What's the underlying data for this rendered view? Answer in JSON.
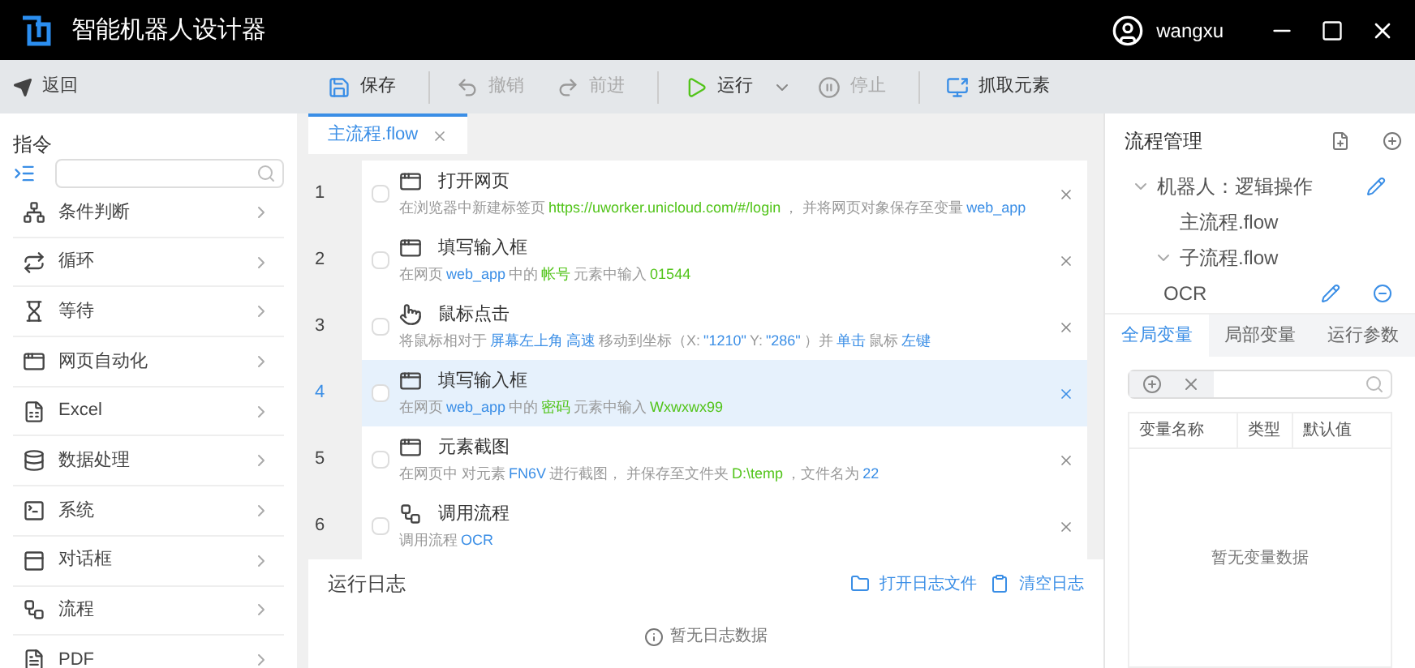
{
  "window": {
    "title": "智能机器人设计器",
    "user": "wangxu"
  },
  "toolbar": {
    "back": "返回",
    "buttons": [
      {
        "kind": "save",
        "label": "保存",
        "disabled": false
      },
      {
        "kind": "undo",
        "label": "撤销",
        "disabled": true
      },
      {
        "kind": "redo",
        "label": "前进",
        "disabled": true
      },
      {
        "kind": "run",
        "label": "运行",
        "disabled": false
      },
      {
        "kind": "stop",
        "label": "停止",
        "disabled": true
      },
      {
        "kind": "capture",
        "label": "抓取元素",
        "disabled": false
      }
    ]
  },
  "sidebar": {
    "title": "指令",
    "items": [
      "条件判断",
      "循环",
      "等待",
      "网页自动化",
      "Excel",
      "数据处理",
      "系统",
      "对话框",
      "流程",
      "PDF"
    ]
  },
  "editor_tabs": [
    {
      "label": "主流程.flow",
      "selected": true
    }
  ],
  "steps": [
    {
      "number": "1",
      "kind": "web",
      "title": "打开网页",
      "selected": false,
      "parts": [
        {
          "kind": "text",
          "text": "在浏览器中新建标签页"
        },
        {
          "kind": "value",
          "text": "https://uworker.unicloud.com/#/login"
        },
        {
          "kind": "text",
          "text": "， 并将网页对象保存至变量"
        },
        {
          "kind": "link",
          "text": "web_app"
        }
      ]
    },
    {
      "number": "2",
      "kind": "web",
      "title": "填写输入框",
      "selected": false,
      "parts": [
        {
          "kind": "text",
          "text": "在网页"
        },
        {
          "kind": "link",
          "text": "web_app"
        },
        {
          "kind": "text",
          "text": "中的"
        },
        {
          "kind": "value",
          "text": "帐号"
        },
        {
          "kind": "text",
          "text": "元素中输入"
        },
        {
          "kind": "value",
          "text": "01544"
        }
      ]
    },
    {
      "number": "3",
      "kind": "mouse",
      "title": "鼠标点击",
      "selected": false,
      "parts": [
        {
          "kind": "text",
          "text": "将鼠标相对于"
        },
        {
          "kind": "link",
          "text": "屏幕左上角"
        },
        {
          "kind": "link",
          "text": "高速"
        },
        {
          "kind": "text",
          "text": "移动到坐标（X:"
        },
        {
          "kind": "link",
          "text": "\"1210\""
        },
        {
          "kind": "text",
          "text": "Y:"
        },
        {
          "kind": "link",
          "text": "\"286\""
        },
        {
          "kind": "text",
          "text": "）并"
        },
        {
          "kind": "link",
          "text": "单击"
        },
        {
          "kind": "text",
          "text": "鼠标"
        },
        {
          "kind": "link",
          "text": "左键"
        }
      ]
    },
    {
      "number": "4",
      "kind": "web",
      "title": "填写输入框",
      "selected": true,
      "parts": [
        {
          "kind": "text",
          "text": "在网页"
        },
        {
          "kind": "link",
          "text": "web_app"
        },
        {
          "kind": "text",
          "text": "中的"
        },
        {
          "kind": "value",
          "text": "密码"
        },
        {
          "kind": "text",
          "text": "元素中输入"
        },
        {
          "kind": "value",
          "text": "Wxwxwx99"
        }
      ]
    },
    {
      "number": "5",
      "kind": "web",
      "title": "元素截图",
      "selected": false,
      "parts": [
        {
          "kind": "text",
          "text": "在网页中 对元素"
        },
        {
          "kind": "link",
          "text": "FN6V"
        },
        {
          "kind": "text",
          "text": "进行截图， 并保存至文件夹"
        },
        {
          "kind": "value",
          "text": "D:\\temp"
        },
        {
          "kind": "text",
          "text": "，文件名为"
        },
        {
          "kind": "link",
          "text": "22"
        }
      ]
    },
    {
      "number": "6",
      "kind": "flow",
      "title": "调用流程",
      "selected": false,
      "parts": [
        {
          "kind": "text",
          "text": "调用流程"
        },
        {
          "kind": "link",
          "text": "OCR"
        }
      ]
    }
  ],
  "log": {
    "title": "运行日志",
    "open_file": "打开日志文件",
    "clear": "清空日志",
    "empty": "暂无日志数据"
  },
  "flow_manager": {
    "title": "流程管理",
    "tree": [
      {
        "label": "机器人：逻辑操作",
        "expanded": true,
        "children": [
          {
            "label": "主流程.flow"
          },
          {
            "label": "子流程.flow",
            "expanded": true,
            "children": [
              {
                "label": "OCR"
              }
            ]
          }
        ]
      }
    ]
  },
  "variable_tabs": [
    {
      "label": "全局变量",
      "selected": true
    },
    {
      "label": "局部变量",
      "selected": false
    },
    {
      "label": "运行参数",
      "selected": false
    }
  ],
  "variables": {
    "columns": [
      "变量名称",
      "类型",
      "默认值"
    ],
    "empty": "暂无变量数据"
  }
}
